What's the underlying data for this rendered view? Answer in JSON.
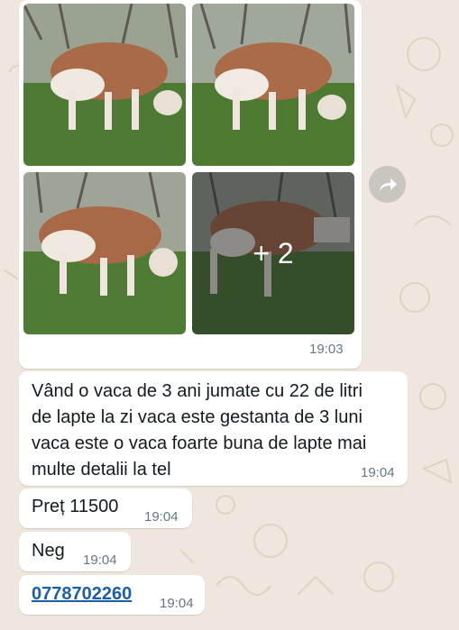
{
  "album": {
    "photos": [
      {
        "icon": "cow-photo"
      },
      {
        "icon": "cow-photo"
      },
      {
        "icon": "cow-photo"
      },
      {
        "icon": "cow-photo",
        "more_count": "+ 2"
      }
    ],
    "time": "19:03",
    "forward_icon": "forward-icon"
  },
  "messages": [
    {
      "lines": [
        "Vând o vaca de 3 ani jumate cu 22 de litri",
        "de lapte la zi vaca este gestanta de 3 luni",
        "vaca este o vaca foarte buna de lapte mai",
        "multe detalii la tel"
      ],
      "time": "19:04"
    },
    {
      "text": "Preț 11500",
      "time": "19:04"
    },
    {
      "text": "Neg",
      "time": "19:04"
    },
    {
      "text": "0778702260",
      "time": "19:04",
      "is_link": true
    }
  ],
  "colors": {
    "background": "#efe7dd",
    "bubble": "#ffffff",
    "time": "#667781",
    "link": "#1b5fab"
  }
}
